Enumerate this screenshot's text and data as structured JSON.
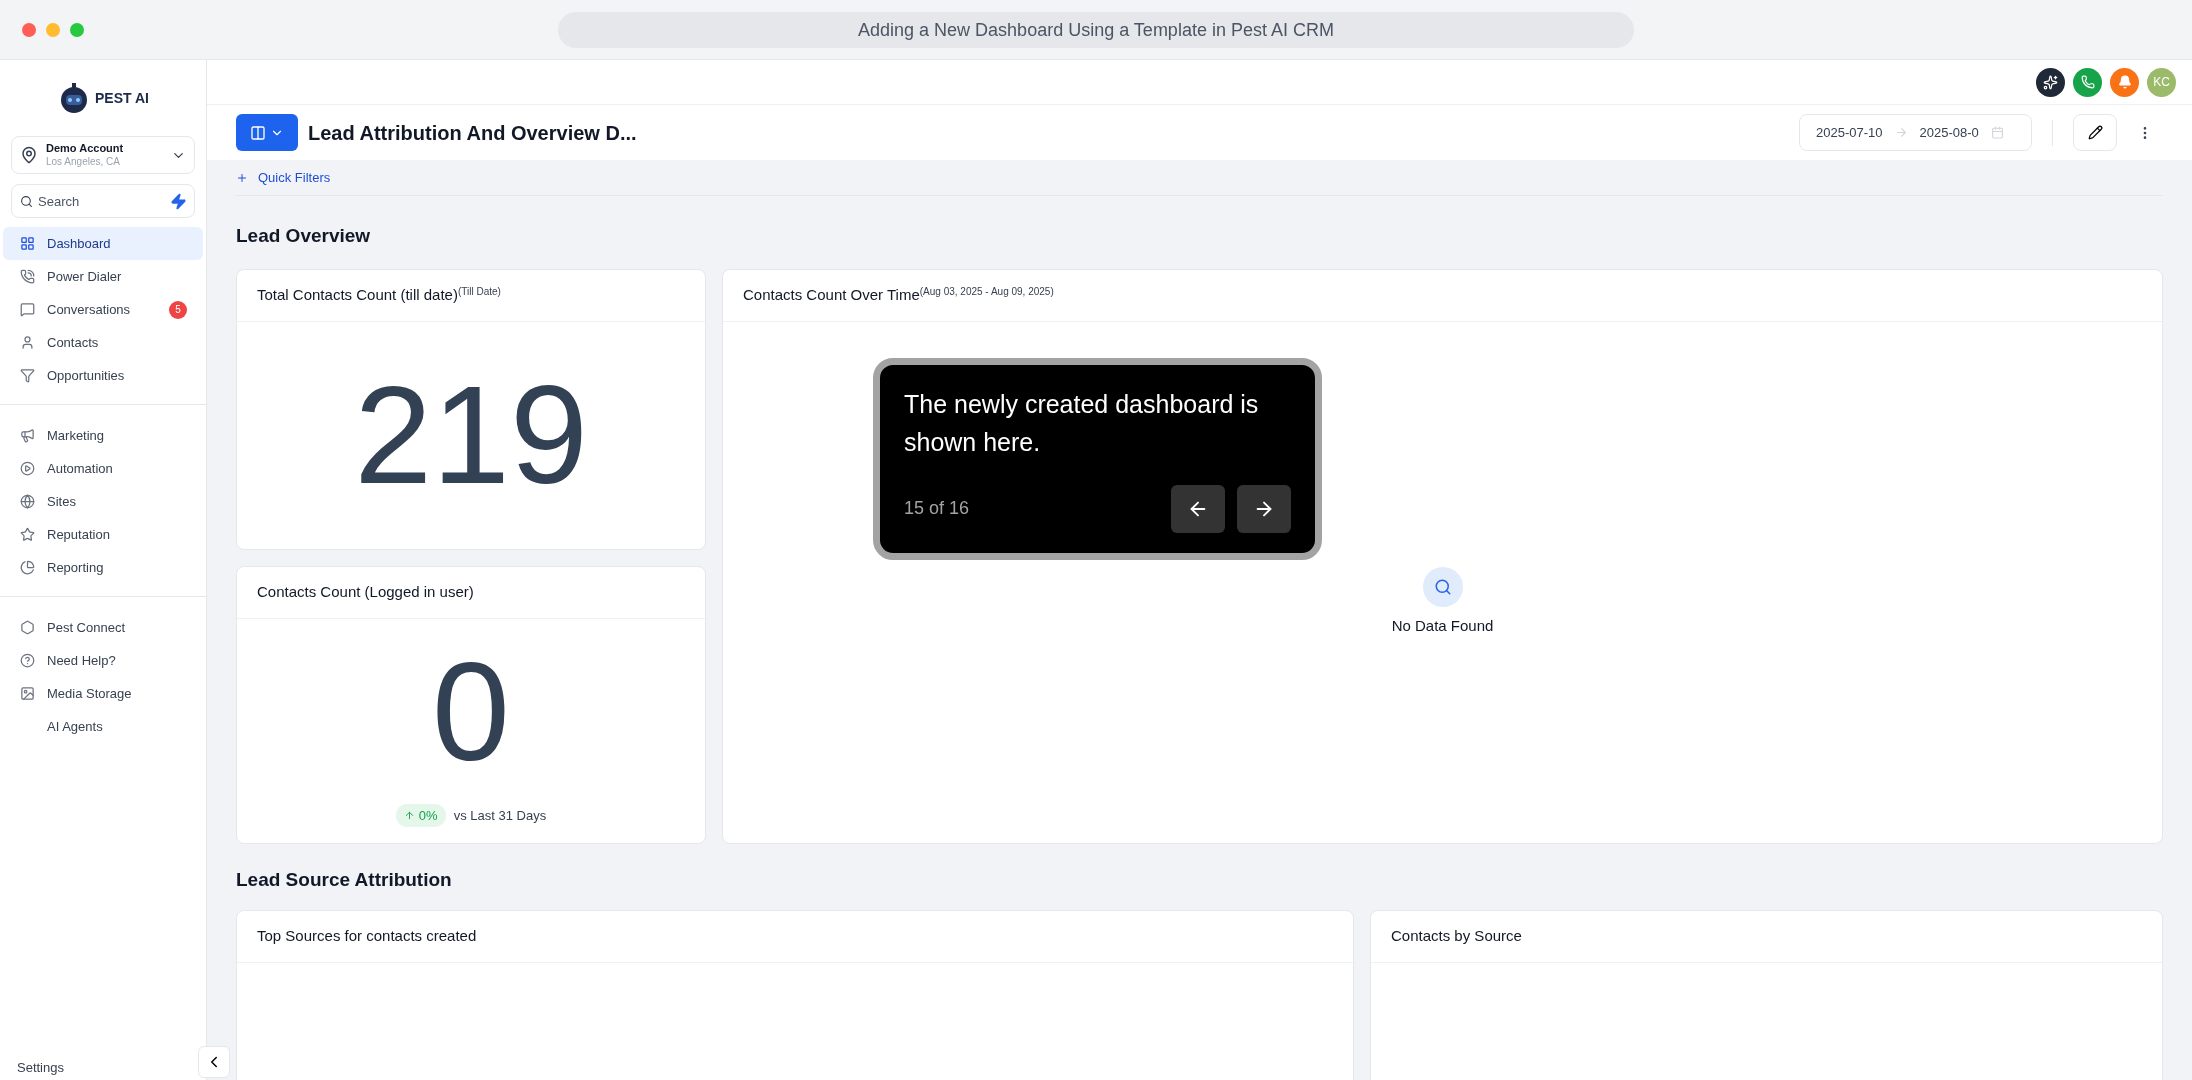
{
  "window": {
    "title": "Adding a New Dashboard Using a Template in Pest AI CRM"
  },
  "sidebar": {
    "logo_text": "PEST AI",
    "account": {
      "name": "Demo Account",
      "location": "Los Angeles, CA"
    },
    "search": {
      "placeholder": "Search"
    },
    "groups": [
      [
        {
          "label": "Dashboard",
          "selected": true
        },
        {
          "label": "Power Dialer",
          "selected": false
        },
        {
          "label": "Conversations",
          "selected": false,
          "badge": "5"
        },
        {
          "label": "Contacts",
          "selected": false
        },
        {
          "label": "Opportunities",
          "selected": false
        }
      ],
      [
        {
          "label": "Marketing",
          "selected": false
        },
        {
          "label": "Automation",
          "selected": false
        },
        {
          "label": "Sites",
          "selected": false
        },
        {
          "label": "Reputation",
          "selected": false
        },
        {
          "label": "Reporting",
          "selected": false
        }
      ],
      [
        {
          "label": "Pest Connect",
          "selected": false
        },
        {
          "label": "Need Help?",
          "selected": false
        },
        {
          "label": "Media Storage",
          "selected": false
        },
        {
          "label": "AI Agents",
          "selected": false
        }
      ]
    ],
    "settings": "Settings"
  },
  "topbar": {
    "avatar": "KC"
  },
  "header": {
    "title": "Lead Attribution And Overview D...",
    "date_from": "2025-07-10",
    "date_to": "2025-08-0"
  },
  "quick_filters": "Quick Filters",
  "sections": [
    {
      "title": "Lead Overview"
    },
    {
      "title": "Lead Source Attribution"
    }
  ],
  "cards": {
    "total": {
      "title": "Total Contacts Count (till date)",
      "sub": "(Till Date)",
      "value": "219"
    },
    "logged": {
      "title": "Contacts Count (Logged in user)",
      "value": "0",
      "change": "0%",
      "compare": "vs Last 31 Days"
    },
    "over_time": {
      "title": "Contacts Count Over Time",
      "sub": "(Aug 03, 2025 - Aug 09, 2025)",
      "empty": "No Data Found"
    },
    "top_sources": {
      "title": "Top Sources for contacts created"
    },
    "by_source": {
      "title": "Contacts by Source"
    }
  },
  "tour": {
    "text": "The newly created dashboard is shown here.",
    "step": "15 of 16"
  }
}
